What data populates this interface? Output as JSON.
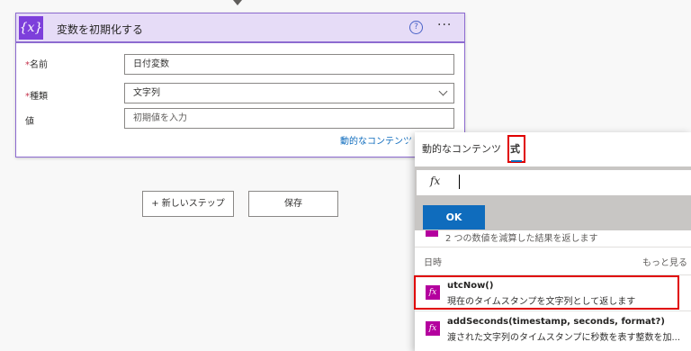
{
  "card": {
    "title": "変数を初期化する",
    "icon_glyph": "{x}",
    "help_glyph": "?",
    "more_glyph": "···",
    "fields": {
      "name": {
        "label": "名前",
        "value": "日付変数"
      },
      "type": {
        "label": "種類",
        "value": "文字列"
      },
      "value": {
        "label": "値",
        "placeholder": "初期値を入力"
      }
    },
    "required_mark": "*",
    "dynamic_link": "動的なコンテンツ"
  },
  "buttons": {
    "new_step": "+ 新しいステップ",
    "save": "保存"
  },
  "panel": {
    "tabs": [
      "動的なコンテンツ",
      "式"
    ],
    "active_tab": "式",
    "fx_glyph": "fx",
    "ok_label": "OK",
    "prev_desc": "2 つの数値を減算した結果を返します",
    "section_title": "日時",
    "section_more": "もっと見る",
    "functions": [
      {
        "name": "utcNow()",
        "desc": "現在のタイムスタンプを文字列として返します"
      },
      {
        "name": "addSeconds(timestamp, seconds, format?)",
        "desc": "渡された文字列のタイムスタンプに秒数を表す整数を加..."
      }
    ]
  },
  "colors": {
    "accent": "#7d3fdb",
    "header_bg": "#e6dcf7",
    "primary_blue": "#0f6cbd",
    "function_magenta": "#b4009e",
    "highlight_red": "#e00000"
  }
}
